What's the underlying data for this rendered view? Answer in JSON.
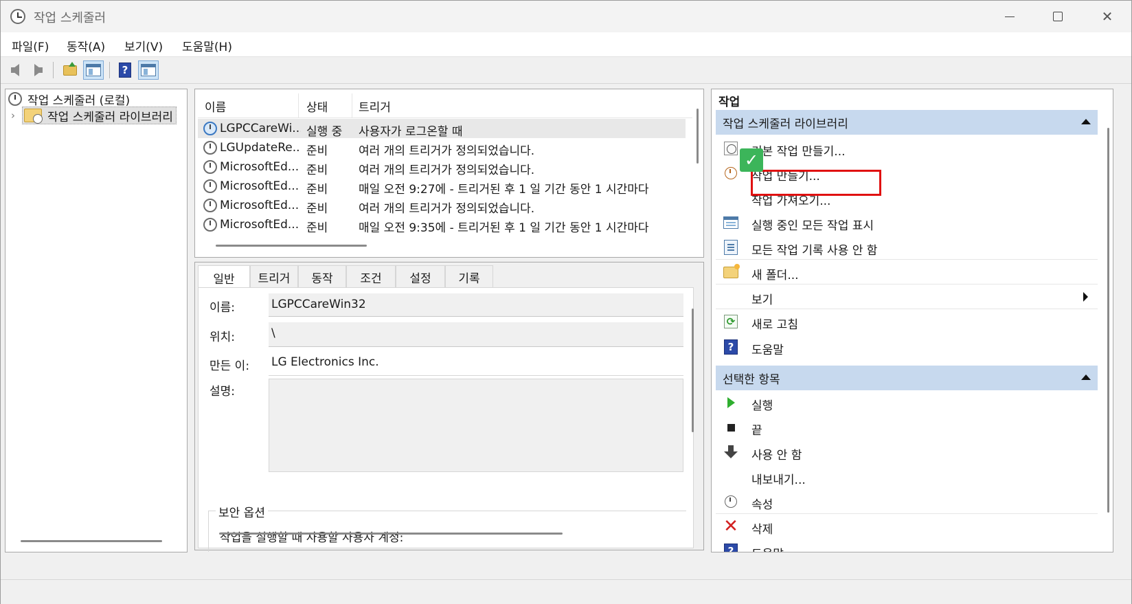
{
  "window": {
    "title": "작업 스케줄러"
  },
  "menu": {
    "file": "파일(F)",
    "action": "동작(A)",
    "view": "보기(V)",
    "help": "도움말(H)"
  },
  "tree": {
    "root": "작업 스케줄러 (로컬)",
    "library": "작업 스케줄러 라이브러리"
  },
  "list": {
    "headers": {
      "name": "이름",
      "status": "상태",
      "trigger": "트리거"
    },
    "rows": [
      {
        "name": "LGPCCareWi...",
        "status": "실행 중",
        "trigger": "사용자가 로그온할 때"
      },
      {
        "name": "LGUpdateRe...",
        "status": "준비",
        "trigger": "여러 개의 트리거가 정의되었습니다."
      },
      {
        "name": "MicrosoftEd...",
        "status": "준비",
        "trigger": "여러 개의 트리거가 정의되었습니다."
      },
      {
        "name": "MicrosoftEd...",
        "status": "준비",
        "trigger": "매일 오전 9:27에 - 트리거된 후 1 일 기간 동안 1 시간마다"
      },
      {
        "name": "MicrosoftEd...",
        "status": "준비",
        "trigger": "여러 개의 트리거가 정의되었습니다."
      },
      {
        "name": "MicrosoftEd...",
        "status": "준비",
        "trigger": "매일 오전 9:35에 - 트리거된 후 1 일 기간 동안 1 시간마다"
      }
    ]
  },
  "detail": {
    "tabs": [
      "일반",
      "트리거",
      "동작",
      "조건",
      "설정",
      "기록"
    ],
    "labels": {
      "name": "이름:",
      "location": "위치:",
      "author": "만든 이:",
      "description": "설명:"
    },
    "values": {
      "name": "LGPCCareWin32",
      "location": "\\",
      "author": "LG Electronics Inc.",
      "description": ""
    },
    "security": {
      "title": "보안 옵션",
      "user_account_label": "작업을 실행할 때 사용할 사용자 계정:"
    }
  },
  "actions": {
    "title": "작업",
    "library_section": {
      "header": "작업 스케줄러 라이브러리",
      "items": {
        "create_basic": "기본 작업 만들기...",
        "create_task": "작업 만들기...",
        "import_task": "작업 가져오기...",
        "show_running": "실행 중인 모든 작업 표시",
        "disable_history": "모든 작업 기록 사용 안 함",
        "new_folder": "새 폴더...",
        "view": "보기",
        "refresh": "새로 고침",
        "help": "도움말"
      }
    },
    "selected_section": {
      "header": "선택한 항목",
      "items": {
        "run": "실행",
        "end": "끝",
        "disable": "사용 안 함",
        "export": "내보내기...",
        "properties": "속성",
        "delete": "삭제",
        "help": "도움말"
      }
    }
  },
  "colors": {
    "section_header": "#c7d9ee",
    "highlight": "#e01010",
    "check": "#3cb55a"
  }
}
